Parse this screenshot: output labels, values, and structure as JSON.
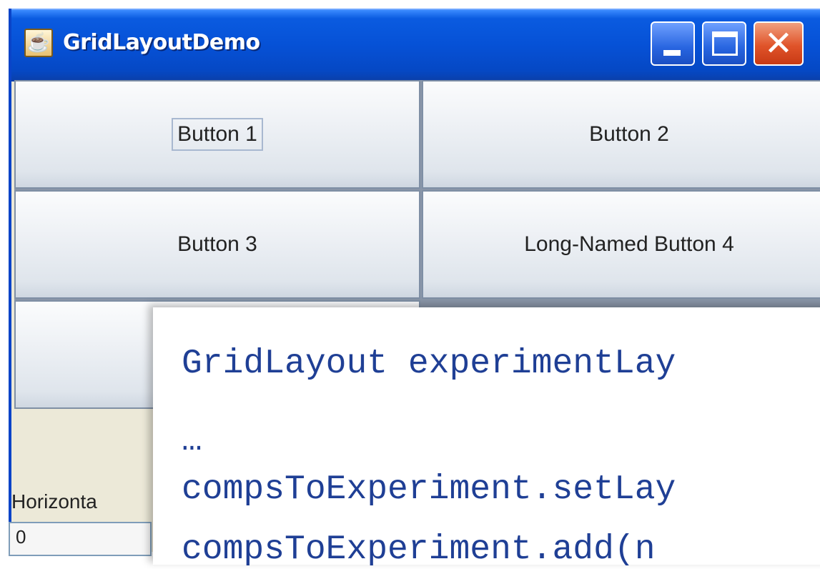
{
  "window": {
    "title": "GridLayoutDemo",
    "icon": "java-coffee-cup-icon",
    "controls": {
      "minimize_icon": "minimize-icon",
      "maximize_icon": "maximize-icon",
      "close_icon": "close-icon",
      "close_glyph": "✕"
    }
  },
  "grid": {
    "buttons": [
      {
        "label": "Button 1"
      },
      {
        "label": "Button 2"
      },
      {
        "label": "Button 3"
      },
      {
        "label": "Long-Named Button 4"
      },
      {
        "label": ""
      }
    ]
  },
  "controls_panel": {
    "horizontal_label": "Horizonta",
    "horizontal_gap_value": "0"
  },
  "code_snippet": {
    "lines": [
      "GridLayout experimentLay",
      "…",
      "compsToExperiment.setLay",
      "compsToExperiment.add(n"
    ]
  },
  "colors": {
    "titlebar": "#0651d6",
    "close_button": "#e0542a",
    "code_text": "#1f3f95"
  }
}
